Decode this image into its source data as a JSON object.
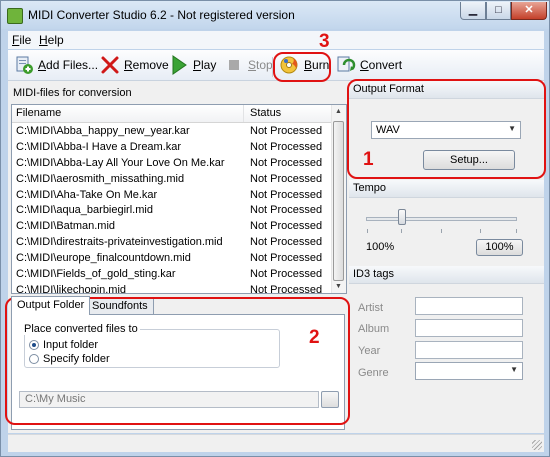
{
  "window": {
    "title": "MIDI Converter Studio 6.2 - Not registered version",
    "min_glyph": "▁",
    "max_glyph": "□",
    "close_glyph": "✕"
  },
  "menu": {
    "items": [
      "File",
      "Help"
    ]
  },
  "toolbar": {
    "add_files": "Add Files...",
    "remove": "Remove",
    "play": "Play",
    "stop": "Stop",
    "burn": "Burn",
    "convert": "Convert"
  },
  "file_list": {
    "caption": "MIDI-files for conversion",
    "columns": [
      "Filename",
      "Status"
    ],
    "rows": [
      {
        "filename": "C:\\MIDI\\Abba_happy_new_year.kar",
        "status": "Not Processed"
      },
      {
        "filename": "C:\\MIDI\\Abba-I Have a Dream.kar",
        "status": "Not Processed"
      },
      {
        "filename": "C:\\MIDI\\Abba-Lay All Your Love On Me.kar",
        "status": "Not Processed"
      },
      {
        "filename": "C:\\MIDI\\aerosmith_missathing.mid",
        "status": "Not Processed"
      },
      {
        "filename": "C:\\MIDI\\Aha-Take On Me.kar",
        "status": "Not Processed"
      },
      {
        "filename": "C:\\MIDI\\aqua_barbiegirl.mid",
        "status": "Not Processed"
      },
      {
        "filename": "C:\\MIDI\\Batman.mid",
        "status": "Not Processed"
      },
      {
        "filename": "C:\\MIDI\\direstraits-privateinvestigation.mid",
        "status": "Not Processed"
      },
      {
        "filename": "C:\\MIDI\\europe_finalcountdown.mid",
        "status": "Not Processed"
      },
      {
        "filename": "C:\\MIDI\\Fields_of_gold_sting.kar",
        "status": "Not Processed"
      },
      {
        "filename": "C:\\MIDI\\likechopin.mid",
        "status": "Not Processed"
      }
    ]
  },
  "tabs": {
    "items": [
      "Output Folder",
      "Soundfonts"
    ],
    "active": "Output Folder"
  },
  "output_folder": {
    "group_title": "Place converted files to",
    "option_input": "Input folder",
    "option_specify": "Specify folder",
    "selected": "Input folder",
    "path": "C:\\My Music"
  },
  "output_format": {
    "header": "Output Format",
    "format": "WAV",
    "setup_button": "Setup..."
  },
  "tempo": {
    "header": "Tempo",
    "value_label": "100%",
    "reset_button": "100%",
    "level_fraction": 0.25
  },
  "id3": {
    "header": "ID3 tags",
    "artist": "Artist",
    "album": "Album",
    "year": "Year",
    "genre": "Genre"
  },
  "annotations": {
    "n1": "1",
    "n2": "2",
    "n3": "3"
  },
  "colors": {
    "annotation": "#e01212",
    "window_frame": "#bfd3ea",
    "titlebar": "#c2d6ec"
  }
}
